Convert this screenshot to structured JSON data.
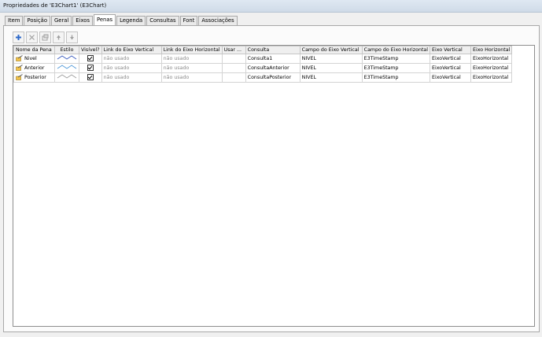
{
  "window": {
    "title": "Propriedades de 'E3Chart1' (E3Chart)"
  },
  "tabs": [
    {
      "label": "Item"
    },
    {
      "label": "Posição"
    },
    {
      "label": "Geral"
    },
    {
      "label": "Eixos"
    },
    {
      "label": "Penas",
      "active": true
    },
    {
      "label": "Legenda"
    },
    {
      "label": "Consultas"
    },
    {
      "label": "Font"
    },
    {
      "label": "Associações"
    }
  ],
  "toolbar": {
    "buttons": [
      {
        "name": "add",
        "icon": "plus-icon"
      },
      {
        "name": "delete",
        "icon": "x-icon"
      },
      {
        "name": "properties",
        "icon": "properties-icon"
      },
      {
        "name": "move-up",
        "icon": "arrow-up-icon"
      },
      {
        "name": "move-down",
        "icon": "arrow-down-icon"
      }
    ]
  },
  "grid": {
    "columns": [
      "Nome da Pena",
      "Estilo",
      "Visível?",
      "Link do Eixo Vertical",
      "Link do Eixo Horizontal",
      "Usar ...",
      "Consulta",
      "Campo do Eixo Vertical",
      "Campo do Eixo Horizontal",
      "Eixo Vertical",
      "Eixo Horizontal"
    ],
    "rows": [
      {
        "name": "Nivel",
        "style_color": "#3355bb",
        "visible": true,
        "vlink": "não usado",
        "hlink": "não usado",
        "usar": "",
        "consulta": "Consulta1",
        "vfield": "NIVEL",
        "hfield": "E3TimeStamp",
        "vaxis": "EixoVertical",
        "haxis": "EixoHorizontal"
      },
      {
        "name": "Anterior",
        "style_color": "#4a96d8",
        "visible": true,
        "vlink": "não usado",
        "hlink": "não usado",
        "usar": "",
        "consulta": "ConsultaAnterior",
        "vfield": "NIVEL",
        "hfield": "E3TimeStamp",
        "vaxis": "EixoVertical",
        "haxis": "EixoHorizontal"
      },
      {
        "name": "Posterior",
        "style_color": "#9a9a9a",
        "visible": true,
        "vlink": "não usado",
        "hlink": "não usado",
        "usar": "",
        "consulta": "ConsultaPosterior",
        "vfield": "NIVEL",
        "hfield": "E3TimeStamp",
        "vaxis": "EixoVertical",
        "haxis": "EixoHorizontal"
      }
    ]
  }
}
